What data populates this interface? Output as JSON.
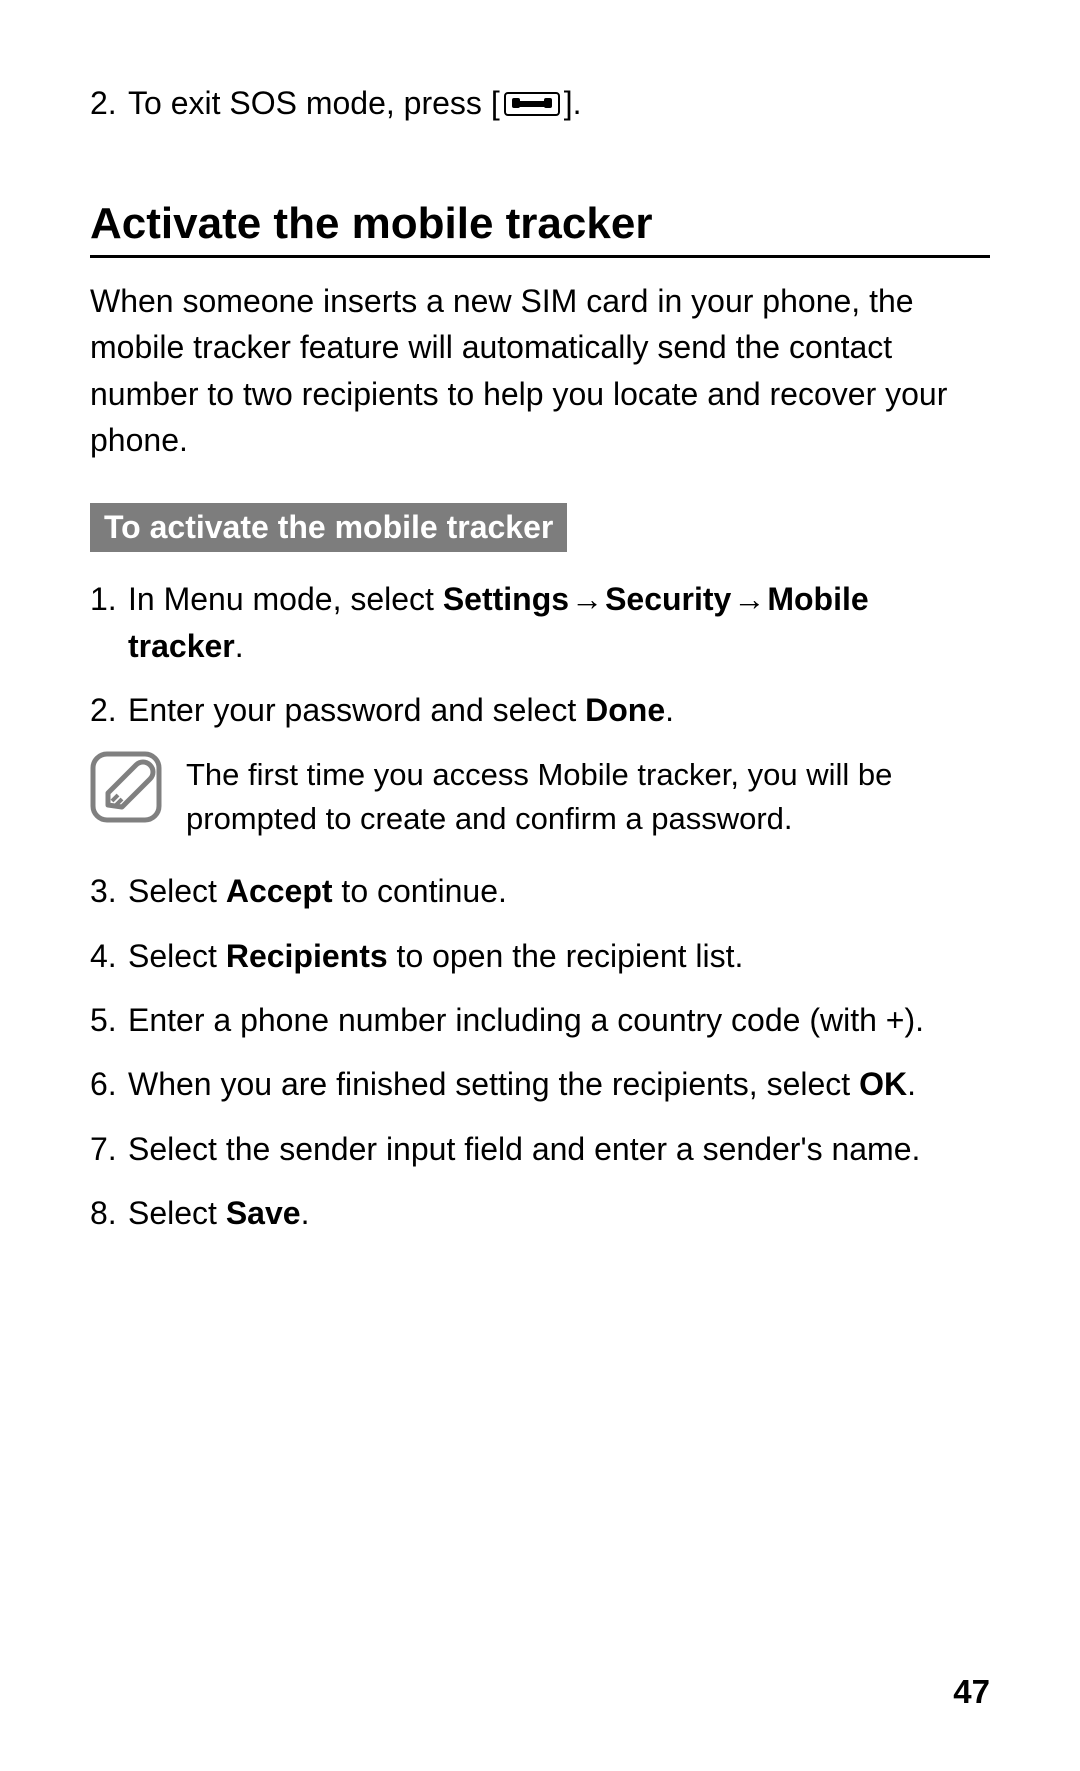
{
  "sos_exit": {
    "num": "2.",
    "text_before": "To exit SOS mode, press [",
    "text_after": "]."
  },
  "heading": "Activate the mobile tracker",
  "intro": "When someone inserts a new SIM card in your phone, the mobile tracker feature will automatically send the contact number to two recipients to help you locate and recover your phone.",
  "sub_heading": "To activate the mobile tracker",
  "step1": {
    "num": "1.",
    "t1": "In Menu mode, select ",
    "b1": "Settings",
    "arrow1": " → ",
    "b2": "Security",
    "arrow2": " → ",
    "b3": "Mobile tracker",
    "t2": "."
  },
  "step2": {
    "num": "2.",
    "t1": "Enter your password and select ",
    "b1": "Done",
    "t2": "."
  },
  "note": "The first time you access Mobile tracker, you will be prompted to create and confirm a password.",
  "step3": {
    "num": "3.",
    "t1": "Select ",
    "b1": "Accept",
    "t2": " to continue."
  },
  "step4": {
    "num": "4.",
    "t1": "Select ",
    "b1": "Recipients",
    "t2": " to open the recipient list."
  },
  "step5": {
    "num": "5.",
    "t1": "Enter a phone number including a country code (with +)."
  },
  "step6": {
    "num": "6.",
    "t1": "When you are finished setting the recipients, select ",
    "b1": "OK",
    "t2": "."
  },
  "step7": {
    "num": "7.",
    "t1": "Select the sender input field and enter a sender's name."
  },
  "step8": {
    "num": "8.",
    "t1": "Select ",
    "b1": "Save",
    "t2": "."
  },
  "page_number": "47"
}
